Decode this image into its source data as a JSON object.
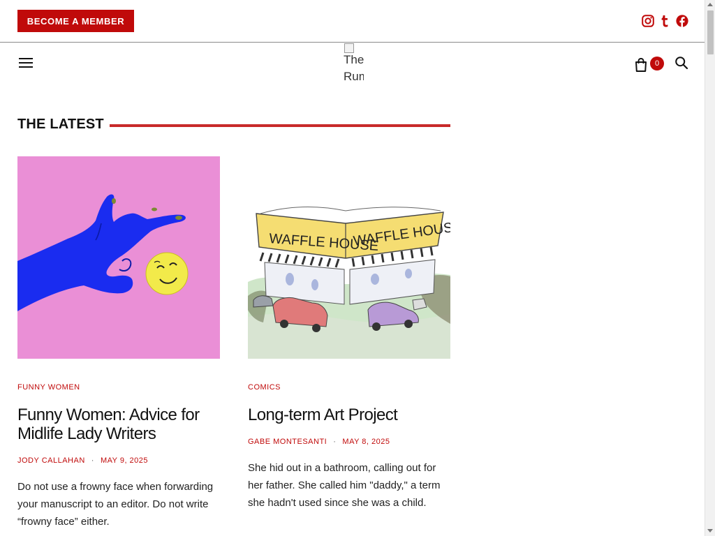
{
  "header": {
    "member_button": "BECOME A MEMBER",
    "social_icons": [
      "instagram-icon",
      "tumblr-icon",
      "facebook-icon"
    ],
    "logo_alt": "The\nRumpus",
    "cart_count": "0"
  },
  "section": {
    "title": "THE LATEST"
  },
  "articles": [
    {
      "category": "FUNNY WOMEN",
      "title": "Funny Women: Advice for Midlife Lady Writers",
      "author": "JODY CALLAHAN",
      "date": "MAY 9, 2025",
      "excerpt": "Do not use a frowny face when forwarding your manuscript to an editor. Do not write “frowny face” either."
    },
    {
      "category": "COMICS",
      "title": "Long-term Art Project",
      "author": "GABE MONTESANTI",
      "date": "MAY 8, 2025",
      "excerpt": "She hid out in a bathroom, calling out for her father. She called him \"daddy,\" a term she hadn't used since she was a child."
    }
  ],
  "colors": {
    "accent": "#c00a0a",
    "rule": "#c82a2a",
    "card1_bg": "#ea8fd6",
    "hand": "#1a2cf0",
    "smiley": "#f2ea4a"
  }
}
